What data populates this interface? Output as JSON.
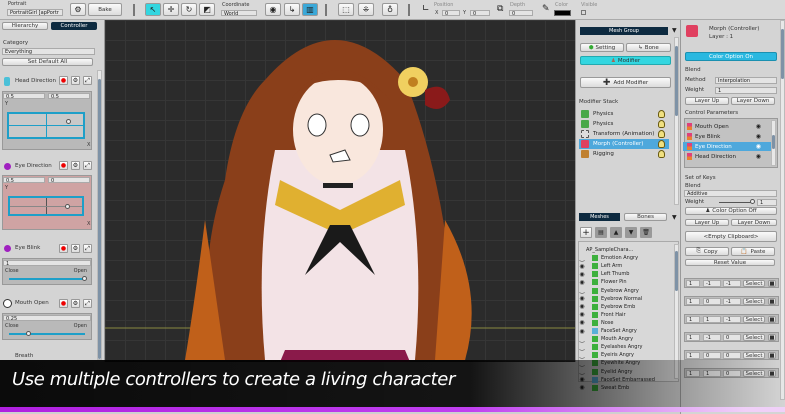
{
  "toolbar": {
    "portrait_label": "Portrait",
    "portrait_value": "PortraitGirl [apPortr",
    "bake": "Bake",
    "coordinate_label": "Coordinate",
    "coordinate_value": "World",
    "position_label": "Position",
    "x_label": "X",
    "x_value": "0",
    "y_label": "Y",
    "y_value": "0",
    "depth_label": "Depth",
    "depth_value": "0",
    "color_label": "Color",
    "visible_label": "Visible"
  },
  "left": {
    "tabs": [
      "Hierarchy",
      "Controller"
    ],
    "category_label": "Category",
    "category_value": "Everything",
    "set_default_all": "Set Default All",
    "controllers": [
      {
        "name": "Head Direction",
        "values": [
          "0.5",
          "0.5"
        ],
        "y": "Y",
        "x": "X"
      },
      {
        "name": "Eye Direction",
        "values": [
          "0.5",
          "0"
        ],
        "y": "Y",
        "x": "X"
      },
      {
        "name": "Eye Blink",
        "value": "1",
        "min": "Close",
        "max": "Open",
        "level": 1.0
      },
      {
        "name": "Mouth Open",
        "value": "0.25",
        "min": "Close",
        "max": "Open",
        "level": 0.25
      },
      {
        "name": "Breath"
      }
    ]
  },
  "mid": {
    "header": "Mesh Group",
    "setting": "Setting",
    "bone": "Bone",
    "modifier": "Modifier",
    "add_modifier": "Add Modifier",
    "stack_label": "Modifier Stack",
    "modifiers": [
      "Physics",
      "Physics",
      "Transform (Animation)",
      "Morph (Controller)",
      "Rigging"
    ],
    "mesh_tabs": [
      "Meshes",
      "Bones"
    ],
    "meshes": [
      "AP_SampleChara...",
      "Emotion Angry",
      "Left Arm",
      "Left Thumb",
      "Flower Pin",
      "Eyebrow Angry",
      "Eyebrow Normal",
      "Eyebrow Emb",
      "Front Hair",
      "Nose",
      "FaceSet Angry",
      "Mouth Angry",
      "Eyelashes Angry",
      "Eyeiris Angry",
      "Eyewhite Angry",
      "Eyelid Angry",
      "FaceSet Embarrassed",
      "Sweat Emb"
    ]
  },
  "right": {
    "title": "Morph (Controller)",
    "layer": "Layer : 1",
    "color_on": "Color Option On",
    "blend": "Blend",
    "method_label": "Method",
    "method_value": "Interpolation",
    "weight_label": "Weight",
    "weight_value": "1",
    "layer_up": "Layer Up",
    "layer_down": "Layer Down",
    "control_params_label": "Control Parameters",
    "params": [
      "Mouth Open",
      "Eye Blink",
      "Eye Direction",
      "Head Direction"
    ],
    "set_of_keys": "Set of Keys",
    "blend2": "Blend",
    "blend2_value": "Additive",
    "weight2_label": "Weight",
    "weight2_value": "1",
    "color_off": "Color Option Off",
    "layer_up2": "Layer Up",
    "layer_down2": "Layer Down",
    "clipboard": "<Empty Clipboard>",
    "copy": "Copy",
    "paste": "Paste",
    "reset": "Reset Value",
    "select": "Select",
    "keys": [
      [
        "1",
        "-1",
        "-1"
      ],
      [
        "1",
        "0",
        "-1"
      ],
      [
        "1",
        "1",
        "-1"
      ],
      [
        "1",
        "-1",
        "0"
      ],
      [
        "1",
        "0",
        "0"
      ],
      [
        "1",
        "1",
        "0"
      ]
    ]
  },
  "caption": "Use multiple controllers to create a living character",
  "colors": {
    "accent": "#33d6e0",
    "selected": "#4ea8dc",
    "caption_bar": "#b020e0"
  }
}
